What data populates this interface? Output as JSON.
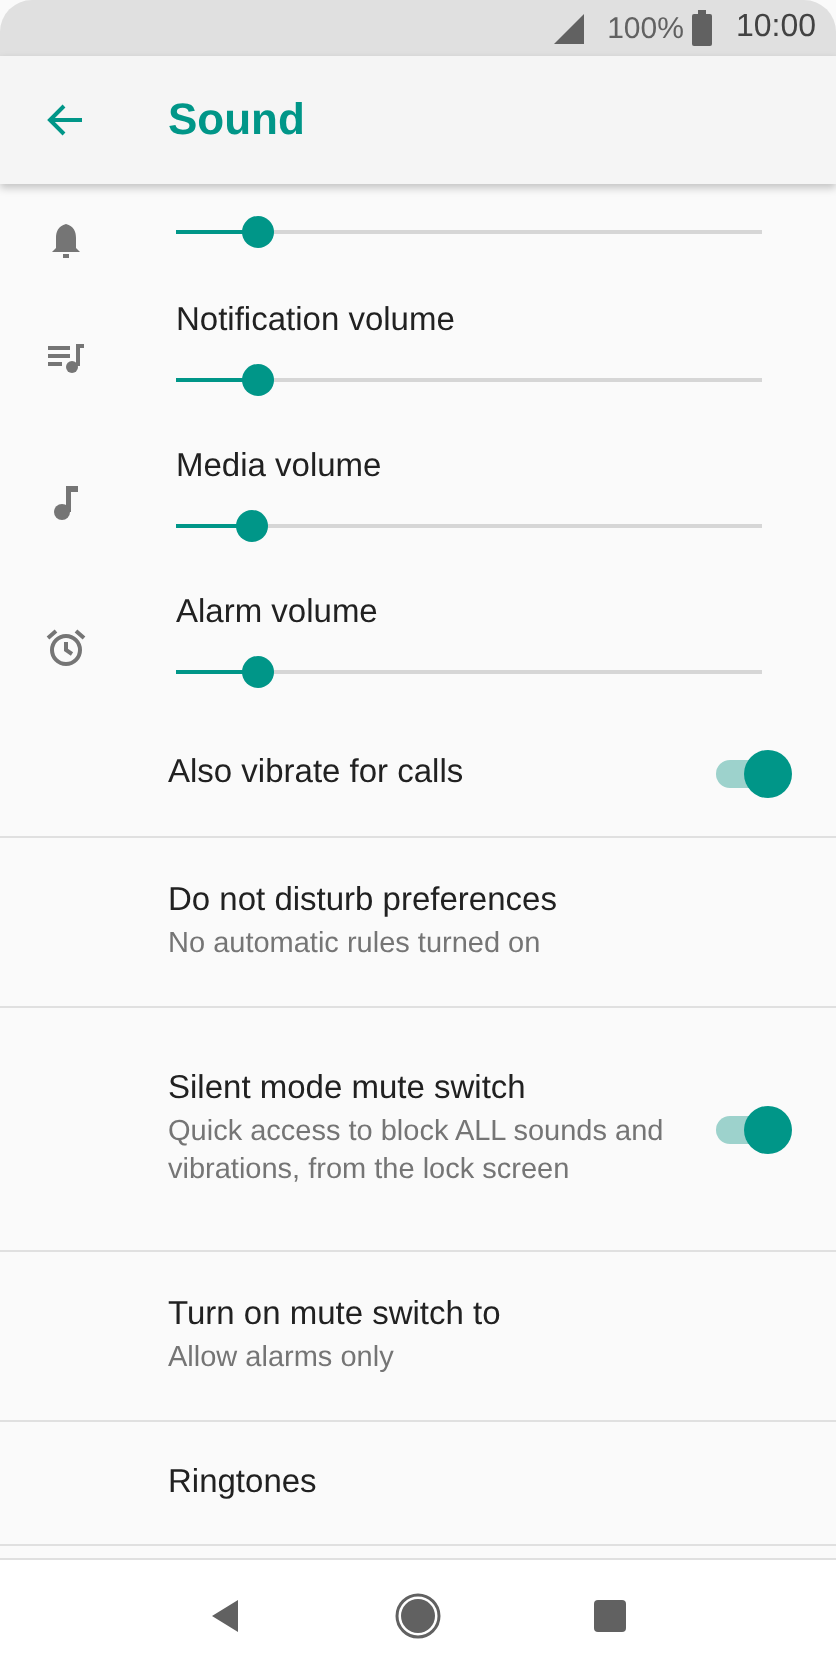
{
  "status_bar": {
    "battery": "100%",
    "time": "10:00"
  },
  "app_bar": {
    "title": "Sound"
  },
  "volumes": [
    {
      "level": 0.14
    },
    {
      "label": "Notification volume",
      "level": 0.14
    },
    {
      "label": "Media volume",
      "level": 0.13
    },
    {
      "label": "Alarm volume",
      "level": 0.14
    }
  ],
  "settings": [
    {
      "kind": "switch",
      "title": "Also vibrate for calls",
      "on": true
    },
    {
      "kind": "text",
      "title": "Do not disturb preferences",
      "subtitle": "No automatic rules turned on"
    },
    {
      "kind": "switch",
      "title": "Silent mode mute switch",
      "subtitle": "Quick access to block ALL sounds and vibrations, from the lock screen",
      "on": true
    },
    {
      "kind": "text",
      "title": "Turn on mute switch to",
      "subtitle": "Allow alarms only"
    },
    {
      "kind": "text",
      "title": "Ringtones"
    }
  ]
}
